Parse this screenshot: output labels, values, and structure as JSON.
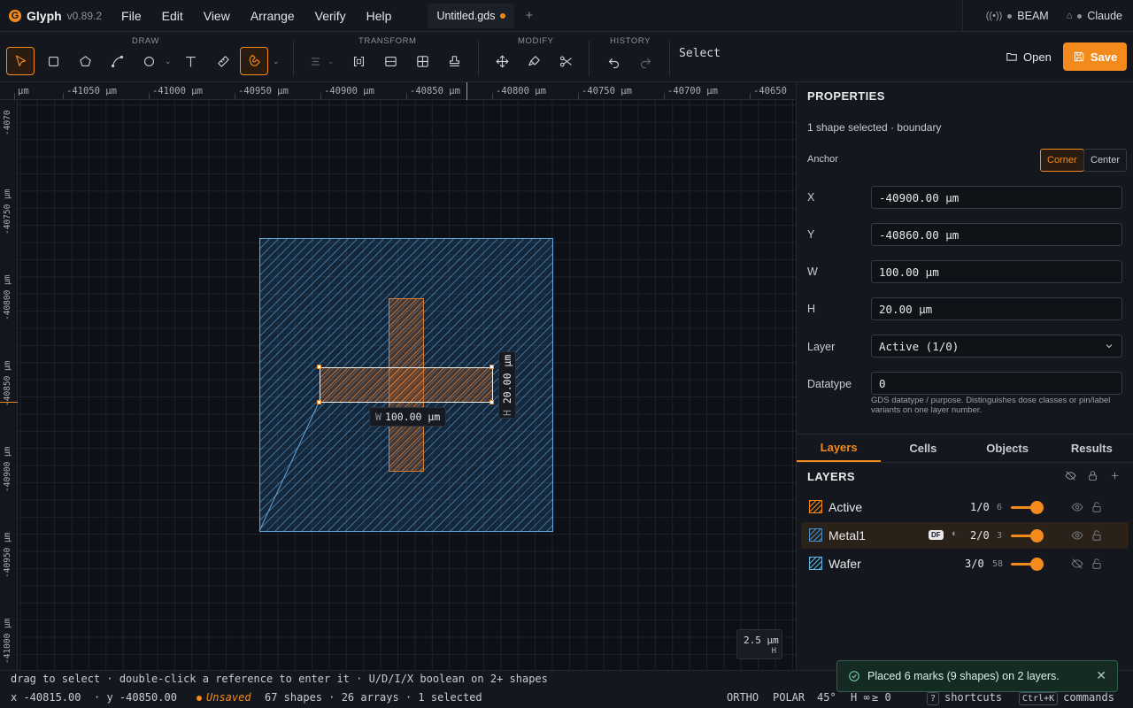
{
  "app": {
    "name": "Glyph",
    "version": "v0.89.2"
  },
  "menus": [
    "File",
    "Edit",
    "View",
    "Arrange",
    "Verify",
    "Help"
  ],
  "document_tab": {
    "title": "Untitled.gds",
    "modified": true
  },
  "connections": [
    {
      "name": "BEAM"
    },
    {
      "name": "Claude"
    }
  ],
  "toolbar": {
    "groups": [
      "DRAW",
      "TRANSFORM",
      "MODIFY",
      "HISTORY"
    ],
    "mode_label": "Select",
    "open_label": "Open",
    "save_label": "Save"
  },
  "ruler": {
    "x_ticks": [
      "µm",
      "-41050 µm",
      "-41000 µm",
      "-40950 µm",
      "-40900 µm",
      "-40850 µm",
      "-40800 µm",
      "-40750 µm",
      "-40700 µm",
      "-40650"
    ],
    "y_ticks": [
      "-4070",
      "-40750 µm",
      "-40800 µm",
      "-40850 µm",
      "-40900 µm",
      "-40950 µm",
      "-41000 µm"
    ]
  },
  "canvas": {
    "dim_w_key": "W",
    "dim_w_value": "100.00 µm",
    "dim_h_key": "H",
    "dim_h_value": "20.00 µm",
    "scale_value": "2.5 µm",
    "scale_axis": "H"
  },
  "properties": {
    "title": "PROPERTIES",
    "selection": "1 shape selected · boundary",
    "anchor_label": "Anchor",
    "anchor_options": [
      "Corner",
      "Center"
    ],
    "fields": {
      "x_label": "X",
      "x_value": "-40900.00 µm",
      "y_label": "Y",
      "y_value": "-40860.00 µm",
      "w_label": "W",
      "w_value": "100.00 µm",
      "h_label": "H",
      "h_value": "20.00 µm",
      "layer_label": "Layer",
      "layer_value": "Active (1/0)",
      "datatype_label": "Datatype",
      "datatype_value": "0"
    },
    "datatype_hint": "GDS datatype / purpose. Distinguishes dose classes or pin/label variants on one layer number."
  },
  "panel_tabs": [
    "Layers",
    "Cells",
    "Objects",
    "Results"
  ],
  "layers_panel": {
    "title": "LAYERS",
    "layers": [
      {
        "name": "Active",
        "number": "1/0",
        "count": "6",
        "color": "#f28a1c",
        "visible": true
      },
      {
        "name": "Metal1",
        "number": "2/0",
        "count": "3",
        "color": "#3f8fd0",
        "visible": true,
        "badge": "DF"
      },
      {
        "name": "Wafer",
        "number": "3/0",
        "count": "58",
        "color": "#5fb8e0",
        "visible": false
      }
    ]
  },
  "hint_bar": "drag to select · double-click a reference to enter it · U/D/I/X boolean on 2+ shapes",
  "status": {
    "cursor_x": "x -40815.00",
    "cursor_y": "· y -40850.00",
    "save_state": "Unsaved",
    "summary": "67 shapes · 26 arrays · 1 selected",
    "ortho": "ORTHO",
    "polar": "POLAR",
    "angle": "45°",
    "h_inf": "H ∞",
    "ge_zero": "≥ 0",
    "shortcuts_key": "?",
    "shortcuts_label": "shortcuts",
    "commands_key": "Ctrl+K",
    "commands_label": "commands"
  },
  "toast": {
    "message": "Placed 6 marks (9 shapes) on 2 layers."
  }
}
